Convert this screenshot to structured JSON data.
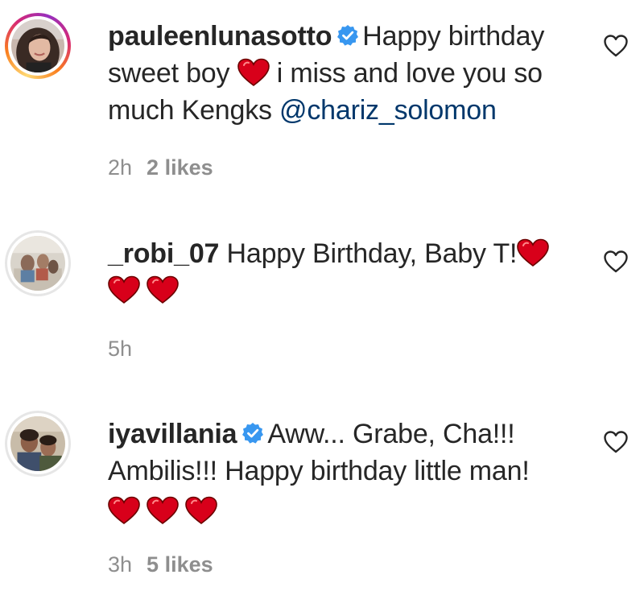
{
  "comments": [
    {
      "username": "pauleenlunasotto",
      "verified": true,
      "text_before_heart": "Happy birthday sweet boy",
      "text_after_heart": "i miss and love you so much Kengks",
      "mention": "@chariz_solomon",
      "time": "2h",
      "likes": "2 likes"
    },
    {
      "username": "_robi_07",
      "verified": false,
      "text": "Happy Birthday, Baby T!",
      "time": "5h"
    },
    {
      "username": "iyavillania",
      "verified": true,
      "text": "Aww... Grabe, Cha!!! Ambilis!!! Happy birthday little man!",
      "time": "3h",
      "likes": "5 likes"
    }
  ],
  "icons": {
    "verified": "verified-badge-icon",
    "like": "heart-outline-icon",
    "emoji": "red-heart-emoji"
  },
  "colors": {
    "text": "#262626",
    "meta": "#8e8e8e",
    "mention": "#00376b",
    "verified": "#3897f0",
    "heart": "#e0001b"
  }
}
